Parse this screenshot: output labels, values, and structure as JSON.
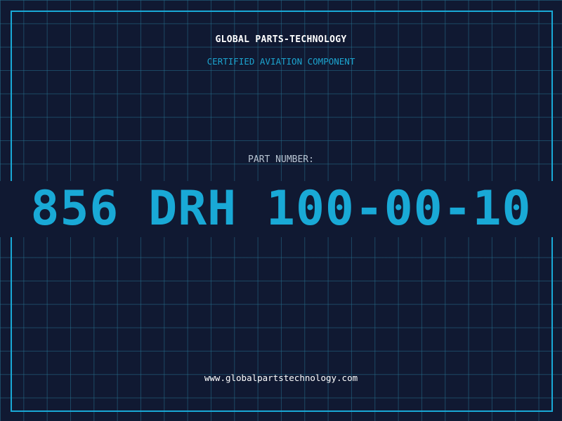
{
  "header": {
    "brand": "GLOBAL PARTS-TECHNOLOGY",
    "subtitle": "CERTIFIED AVIATION COMPONENT"
  },
  "part": {
    "label": "PART NUMBER:",
    "number": "856 DRH 100-00-10"
  },
  "footer": {
    "url": "www.globalpartstechnology.com"
  },
  "colors": {
    "background": "#101932",
    "accent": "#19a9d6",
    "text": "#ffffff",
    "label": "#b8c4d2"
  }
}
